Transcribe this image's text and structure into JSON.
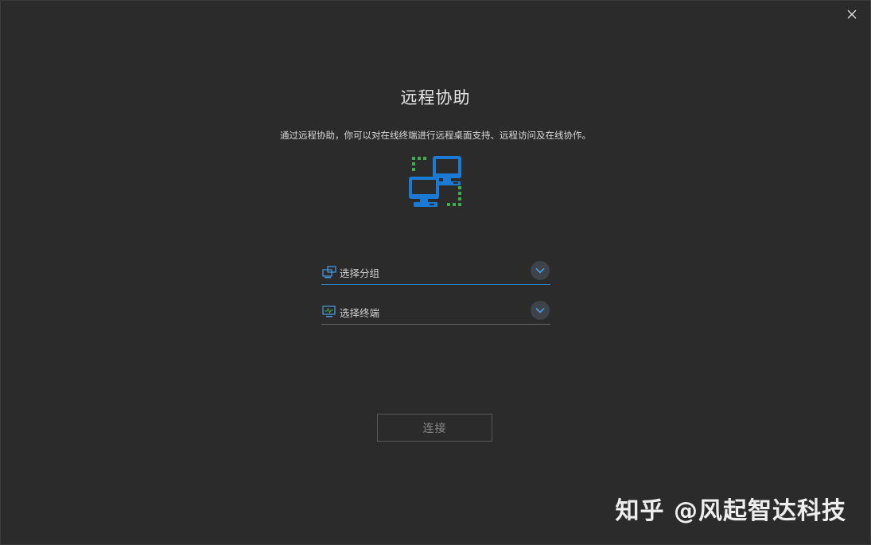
{
  "window": {
    "close_icon": "close-icon"
  },
  "header": {
    "title": "远程协助",
    "description": "通过远程协助，你可以对在线终端进行远程桌面支持、远程访问及在线协作。"
  },
  "hero": {
    "icon": "remote-computers-icon",
    "colors": {
      "monitor": "#1a7ad4",
      "link": "#3cae4b"
    }
  },
  "form": {
    "group_select": {
      "placeholder": "选择分组",
      "icon": "group-icon"
    },
    "terminal_select": {
      "placeholder": "选择终端",
      "icon": "terminal-icon"
    }
  },
  "actions": {
    "connect_label": "连接"
  },
  "watermark": {
    "text": "知乎 @风起智达科技"
  },
  "colors": {
    "background": "#2b2b2b",
    "accent": "#2f82c8"
  }
}
